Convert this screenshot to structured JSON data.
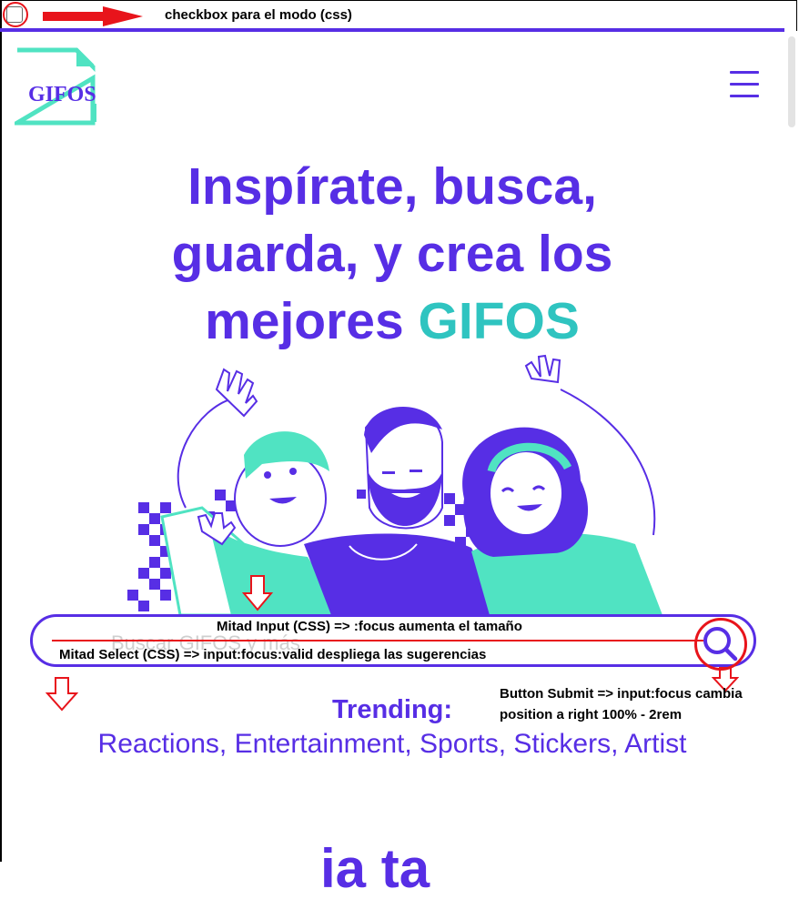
{
  "annotations": {
    "checkbox_note": "checkbox para el modo (css)",
    "input_note": "Mitad Input (CSS) => :focus aumenta el tamaño",
    "select_note": "Mitad Select (CSS) => input:focus:valid despliega las sugerencias",
    "submit_note_line1": "Button Submit => input:focus cambia",
    "submit_note_line2": "position a right 100% - 2rem"
  },
  "header": {
    "logo_text": "GIFOS",
    "menu_icon": "hamburger-icon"
  },
  "hero": {
    "title_line1": "Inspírate, busca,",
    "title_line2": "guarda, y crea los",
    "title_line3_prefix": "mejores ",
    "title_line3_accent": "GIFOS"
  },
  "search": {
    "placeholder": "Buscar GIFOS y más",
    "button_icon": "search-icon"
  },
  "trending": {
    "title": "Trending:",
    "topics": "Reactions, Entertainment, Sports, Stickers, Artist"
  },
  "next_section_partial": "ia ta",
  "colors": {
    "brand_purple": "#572ee5",
    "brand_teal": "#50e3c2",
    "annotation_red": "#e8141b"
  }
}
